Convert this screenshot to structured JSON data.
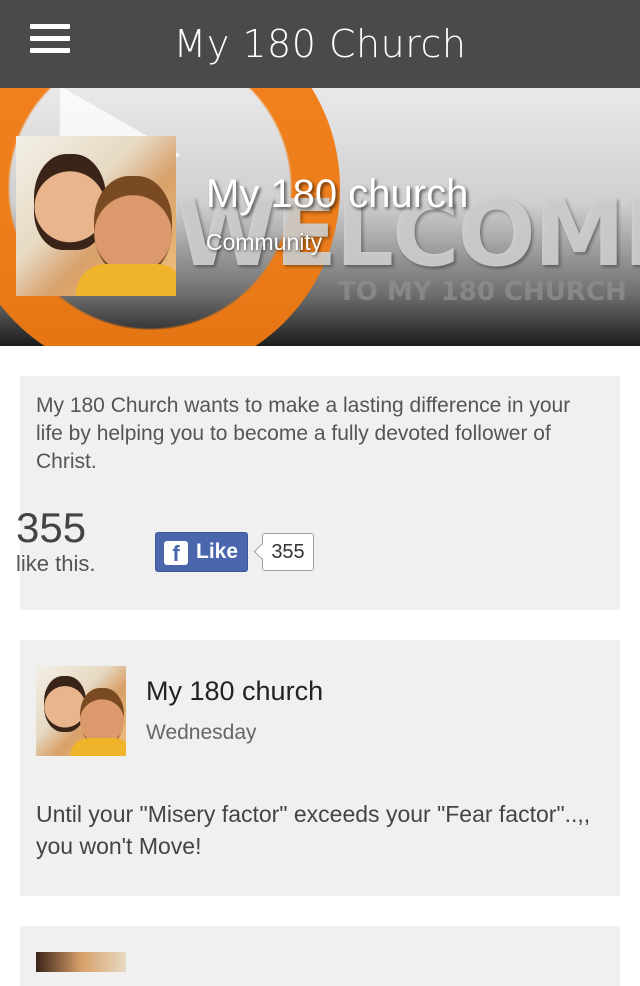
{
  "app": {
    "title": "My 180 Church",
    "menu_icon": "hamburger-menu-icon"
  },
  "banner": {
    "name": "My 180 church",
    "category": "Community",
    "background_text": "WELCOME",
    "background_subtext": "TO MY 180 CHURCH"
  },
  "about": {
    "description": "My 180 Church wants to make a lasting difference in your life by helping you to become a fully devoted follower of Christ.",
    "like_count": "355",
    "like_suffix": "like this.",
    "fb_like_label": "Like",
    "fb_icon": "facebook-f-icon",
    "fb_count": "355"
  },
  "posts": [
    {
      "author": "My 180 church",
      "date": "Wednesday",
      "text": "Until your \"Misery factor\" exceeds your \"Fear factor\"..,, you won't Move!"
    }
  ],
  "colors": {
    "topbar": "#4a4a4a",
    "card_bg": "#f0f0f0",
    "facebook_blue": "#4a66ad",
    "logo_orange": "#f07a12"
  }
}
